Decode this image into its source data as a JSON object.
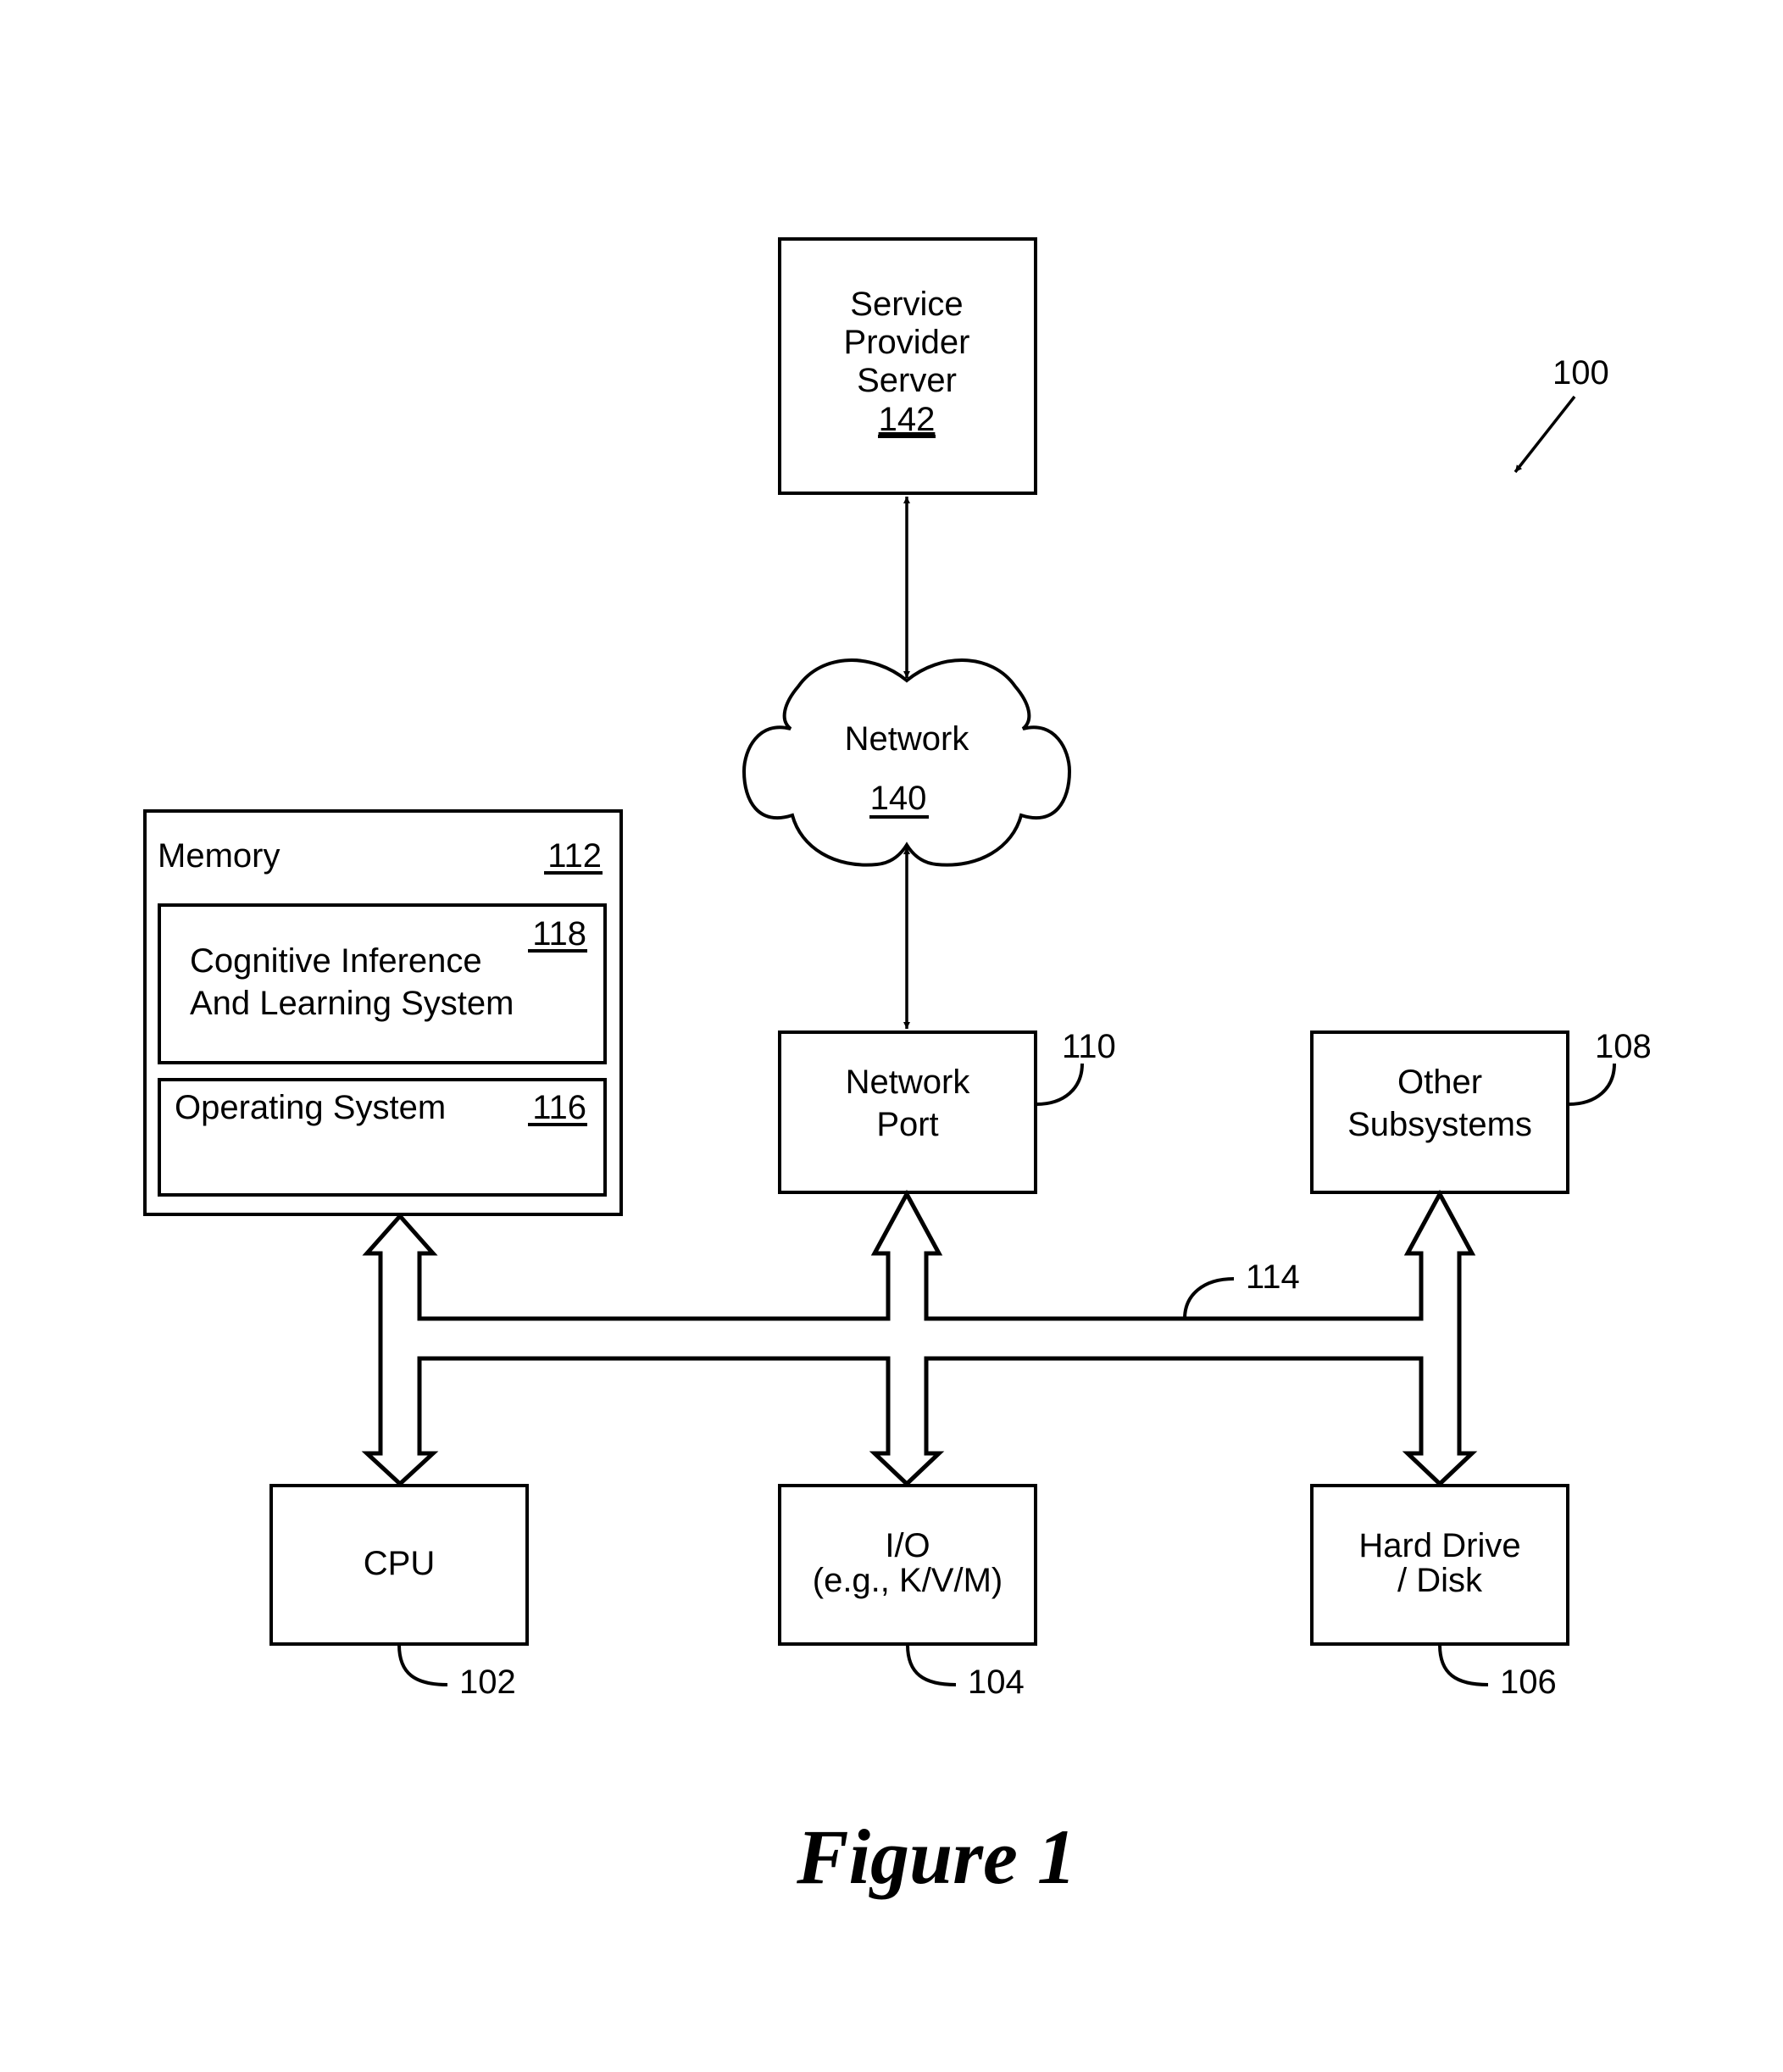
{
  "figure": {
    "caption": "Figure 1",
    "system_ref": "100",
    "bus_ref": "114"
  },
  "nodes": {
    "server": {
      "lines": [
        "Service",
        "Provider",
        "Server"
      ],
      "ref": "142"
    },
    "network": {
      "label": "Network",
      "ref": "140"
    },
    "memory": {
      "label": "Memory",
      "ref": "112"
    },
    "cils": {
      "lines": [
        "Cognitive Inference",
        "And Learning System"
      ],
      "ref": "118"
    },
    "os": {
      "label": "Operating System",
      "ref": "116"
    },
    "network_port": {
      "lines": [
        "Network",
        "Port"
      ],
      "ref": "110"
    },
    "other": {
      "lines": [
        "Other",
        "Subsystems"
      ],
      "ref": "108"
    },
    "cpu": {
      "label": "CPU",
      "ref": "102"
    },
    "io": {
      "lines": [
        "I/O",
        "(e.g., K/V/M)"
      ],
      "ref": "104"
    },
    "disk": {
      "lines": [
        "Hard Drive",
        "/ Disk"
      ],
      "ref": "106"
    }
  },
  "connections": [
    {
      "from": "server",
      "to": "network",
      "type": "bidirectional"
    },
    {
      "from": "network",
      "to": "network_port",
      "type": "bidirectional"
    },
    {
      "from": "memory",
      "to": "bus",
      "type": "bus-bidirectional"
    },
    {
      "from": "network_port",
      "to": "bus",
      "type": "bus-bidirectional"
    },
    {
      "from": "other",
      "to": "bus",
      "type": "bus-bidirectional"
    },
    {
      "from": "bus",
      "to": "cpu",
      "type": "bus-bidirectional"
    },
    {
      "from": "bus",
      "to": "io",
      "type": "bus-bidirectional"
    },
    {
      "from": "bus",
      "to": "disk",
      "type": "bus-bidirectional"
    }
  ]
}
